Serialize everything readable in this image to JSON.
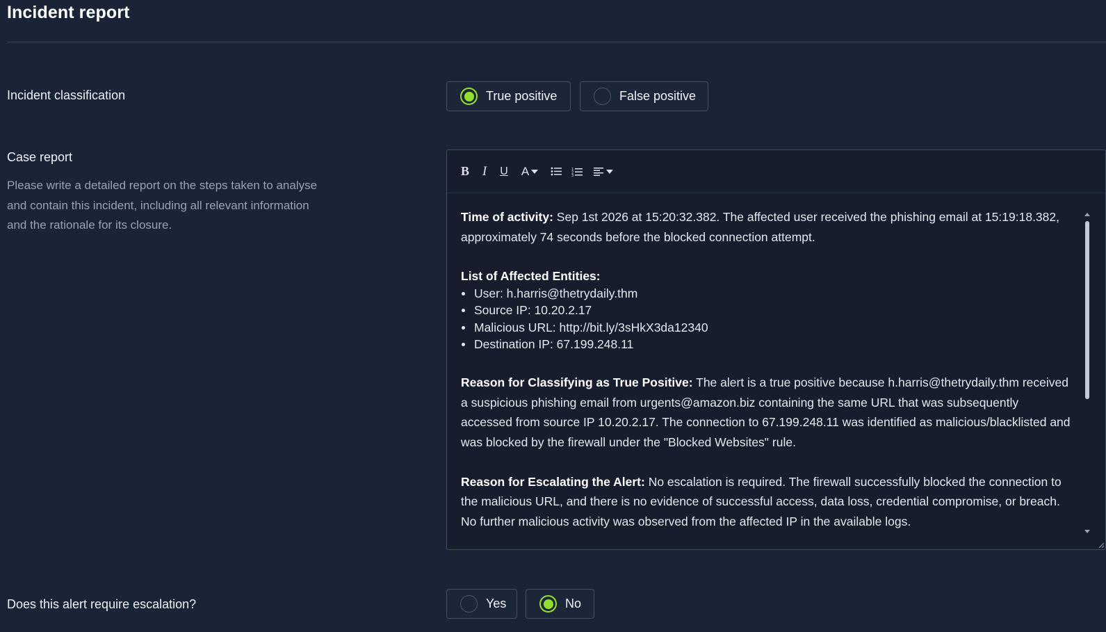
{
  "header": {
    "title": "Incident report"
  },
  "classification": {
    "label": "Incident classification",
    "options": [
      {
        "label": "True positive",
        "selected": true
      },
      {
        "label": "False positive",
        "selected": false
      }
    ]
  },
  "case_report": {
    "label": "Case report",
    "hint": "Please write a detailed report on the steps taken to analyse and contain this incident, including all relevant information and the rationale for its closure.",
    "toolbar": {
      "bold": "B",
      "italic": "I",
      "underline": "U",
      "font_color": "A",
      "icons": [
        "bold-icon",
        "italic-icon",
        "underline-icon",
        "font-color-icon",
        "bullet-list-icon",
        "numbered-list-icon",
        "align-icon"
      ]
    },
    "body": {
      "time_heading": "Time of activity:",
      "time_text": " Sep 1st 2026 at 15:20:32.382. The affected user received the phishing email at 15:19:18.382, approximately 74 seconds before the blocked connection attempt.",
      "entities_heading": "List of Affected Entities:",
      "entities": [
        "User: h.harris@thetrydaily.thm",
        "Source IP: 10.20.2.17",
        "Malicious URL: http://bit.ly/3sHkX3da12340",
        "Destination IP: 67.199.248.11"
      ],
      "reason_tp_heading": "Reason for Classifying as True Positive:",
      "reason_tp_text": " The alert is a true positive because h.harris@thetrydaily.thm received a suspicious phishing email from urgents@amazon.biz containing the same URL that was subsequently accessed from source IP 10.20.2.17. The connection to 67.199.248.11 was identified as malicious/blacklisted and was blocked by the firewall under the \"Blocked Websites\" rule.",
      "reason_esc_heading": "Reason for Escalating the Alert:",
      "reason_esc_text": " No escalation is required. The firewall successfully blocked the connection to the malicious URL, and there is no evidence of successful access, data loss, credential compromise, or breach. No further malicious activity was observed from the affected IP in the available logs."
    }
  },
  "escalation": {
    "label": "Does this alert require escalation?",
    "options": [
      {
        "label": "Yes",
        "selected": false
      },
      {
        "label": "No",
        "selected": true
      }
    ]
  },
  "colors": {
    "background": "#1b2436",
    "editor_background": "#161e2e",
    "accent_green": "#8fe02f",
    "border": "#455065",
    "muted_text": "#98a2b3"
  }
}
